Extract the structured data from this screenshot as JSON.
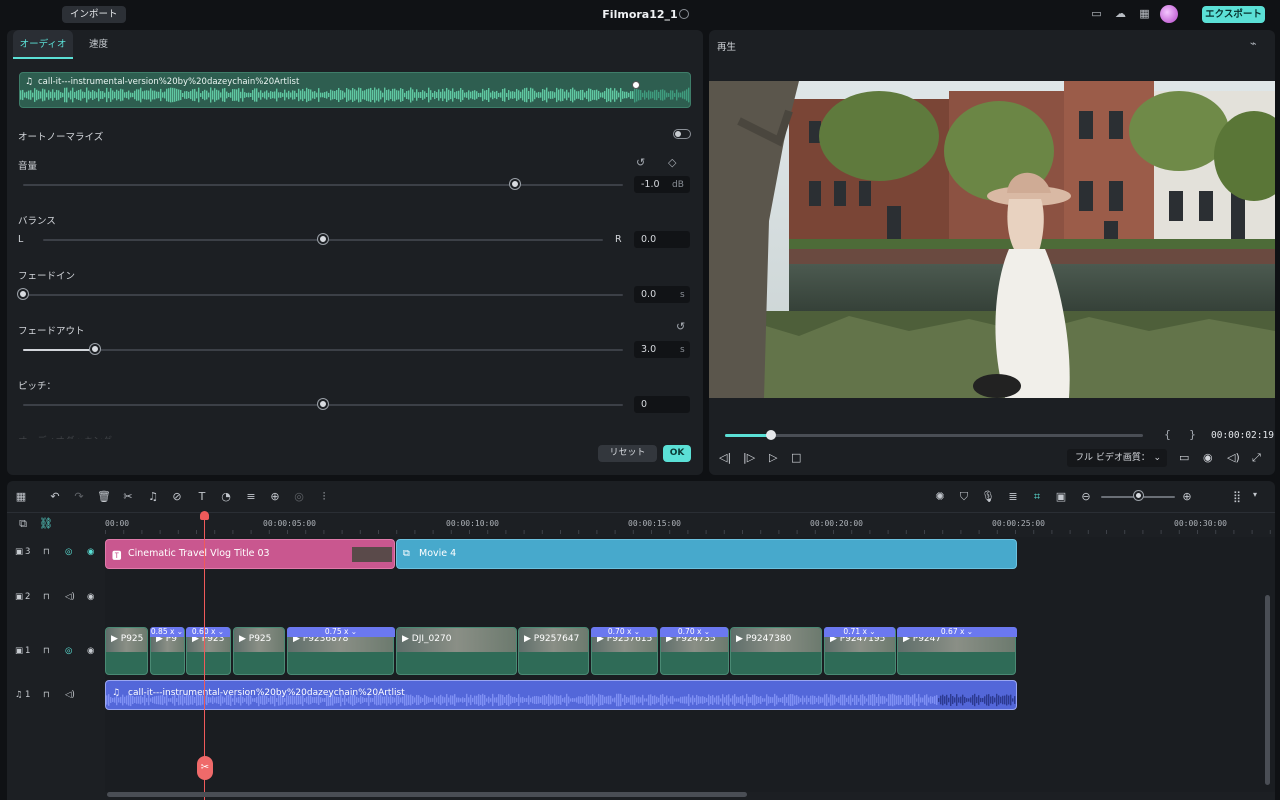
{
  "topbar": {
    "import_label": "インポート",
    "project_title": "Filmora12_1",
    "export_label": "エクスポート"
  },
  "audio_panel": {
    "tabs": [
      {
        "label": "オーディオ",
        "active": true
      },
      {
        "label": "速度",
        "active": false
      }
    ],
    "clip_name": "call-it---instrumental-version%20by%20dazeychain%20Artlist",
    "auto_normalize_label": "オートノーマライズ",
    "auto_normalize_on": false,
    "volume": {
      "label": "音量",
      "value": "-1.0",
      "unit": "dB",
      "level": 0.82
    },
    "balance": {
      "label": "バランス",
      "left": "L",
      "right": "R",
      "value": "0.0",
      "level": 0.5
    },
    "fade_in": {
      "label": "フェードイン",
      "value": "0.0",
      "unit": "s",
      "level": 0.0
    },
    "fade_out": {
      "label": "フェードアウト",
      "value": "3.0",
      "unit": "s",
      "level": 0.12
    },
    "pitch": {
      "label": "ピッチ：",
      "value": "0",
      "level": 0.5
    },
    "hidden_row_label": "オーディオダッキング",
    "reset_label": "リセット",
    "ok_label": "OK"
  },
  "preview": {
    "title": "再生",
    "timecode": "00:00:02:19",
    "mark_in": "{",
    "mark_out": "}",
    "progress": 0.11,
    "quality_label": "フル ビデオ画質："
  },
  "timeline": {
    "ruler": [
      "00:00",
      "00:00:05:00",
      "00:00:10:00",
      "00:00:15:00",
      "00:00:20:00",
      "00:00:25:00",
      "00:00:30:00"
    ],
    "tracks": [
      {
        "name": "3",
        "kind": "video"
      },
      {
        "name": "2",
        "kind": "video"
      },
      {
        "name": "1",
        "kind": "video"
      },
      {
        "name": "1",
        "kind": "audio"
      }
    ],
    "title_clip": "Cinematic Travel Vlog Title 03",
    "movie_clip": "Movie 4",
    "video_clips": [
      "P925",
      "P9",
      "P923",
      "P925",
      "P9236878",
      "DJI_0270",
      "P9257647",
      "P9257615",
      "P924735",
      "P9247380",
      "P9247195",
      "P9247"
    ],
    "speed_tags": [
      "0.85 x",
      "0.60 x",
      "0.75 x",
      "0.70 x",
      "0.70 x",
      "0.71 x",
      "0.67 x"
    ],
    "audio_clip": "call-it---instrumental-version%20by%20dazeychain%20Artlist"
  },
  "colors": {
    "accent": "#5be0d6",
    "title_clip": "#c9578f",
    "movie_clip": "#47a9cc",
    "audio_clip": "#5367d9",
    "playhead": "#ef5a5a"
  }
}
